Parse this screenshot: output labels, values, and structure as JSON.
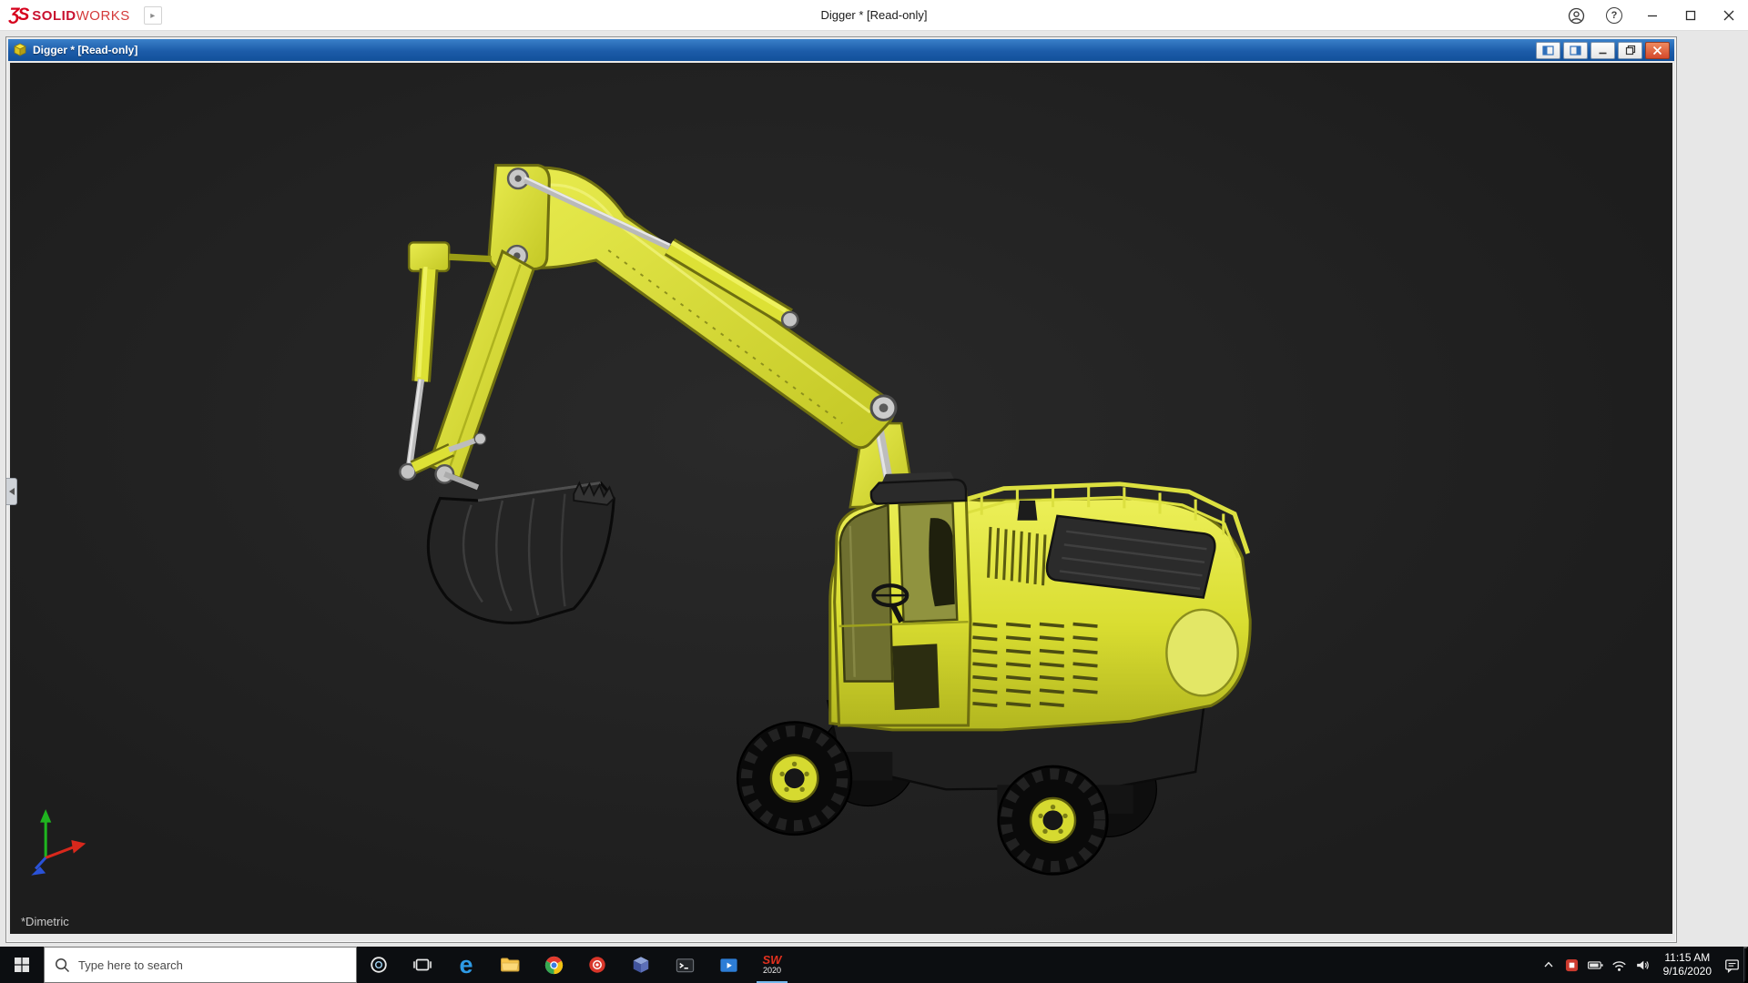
{
  "app_titlebar": {
    "brand": {
      "logo_glyph": "ƷS",
      "name_bold": "SOLID",
      "name_light": "WORKS",
      "expand_glyph": "▸"
    },
    "title": "Digger * [Read-only]",
    "help_glyph": "?"
  },
  "document_window": {
    "title": "Digger * [Read-only]"
  },
  "viewport": {
    "view_orientation": "*Dimetric",
    "model": "yellow-excavator-digger",
    "triad_colors": {
      "x": "#d8281c",
      "y": "#1fb41f",
      "z": "#2a52d8"
    }
  },
  "taskbar": {
    "search": {
      "placeholder": "Type here to search"
    },
    "pinned_apps": [
      "cortana",
      "task-view",
      "edge",
      "file-explorer",
      "chrome",
      "red-app",
      "cube-app",
      "command-prompt",
      "media-app",
      "solidworks-2020"
    ],
    "edge_glyph": "e",
    "solidworks": {
      "mark": "SW",
      "badge": "2020"
    },
    "tray": {
      "time": "11:15 AM",
      "date": "9/16/2020"
    }
  },
  "colors": {
    "excavator_yellow": "#dde135",
    "doc_titlebar_blue": "#1c5ca9",
    "solidworks_red": "#d6001c",
    "viewport_bg": "#1f1f1f",
    "taskbar_bg": "#0c0e11",
    "close_button_red": "#d4492c"
  }
}
